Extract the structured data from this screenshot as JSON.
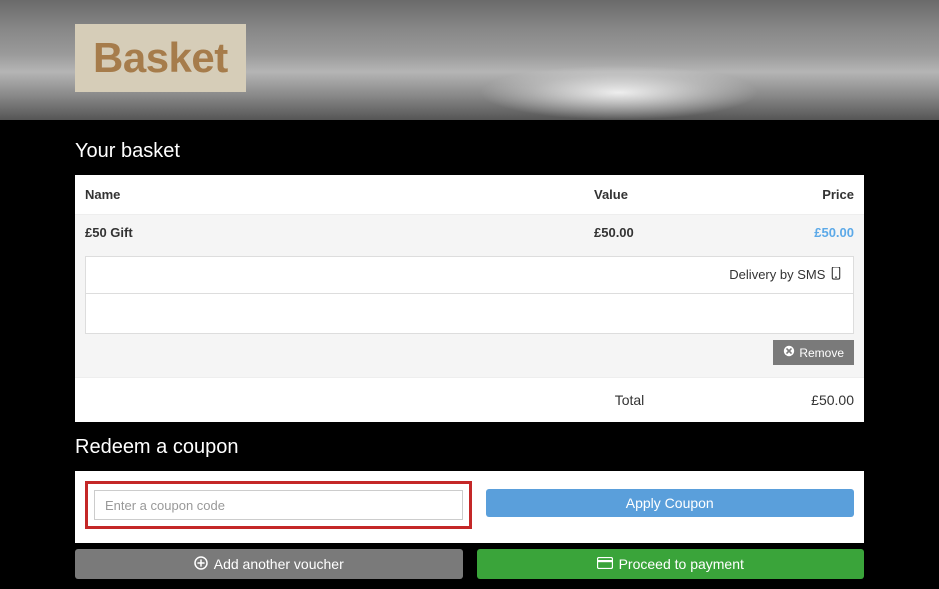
{
  "page": {
    "title": "Basket"
  },
  "basket": {
    "heading": "Your basket",
    "columns": {
      "name": "Name",
      "value": "Value",
      "price": "Price"
    },
    "items": [
      {
        "name": "£50 Gift",
        "value": "£50.00",
        "price": "£50.00",
        "delivery": "Delivery by SMS"
      }
    ],
    "remove_label": "Remove",
    "total_label": "Total",
    "total_amount": "£50.00"
  },
  "coupon": {
    "heading": "Redeem a coupon",
    "placeholder": "Enter a coupon code",
    "apply_label": "Apply Coupon"
  },
  "actions": {
    "add_voucher": "Add another voucher",
    "proceed": "Proceed to payment"
  }
}
